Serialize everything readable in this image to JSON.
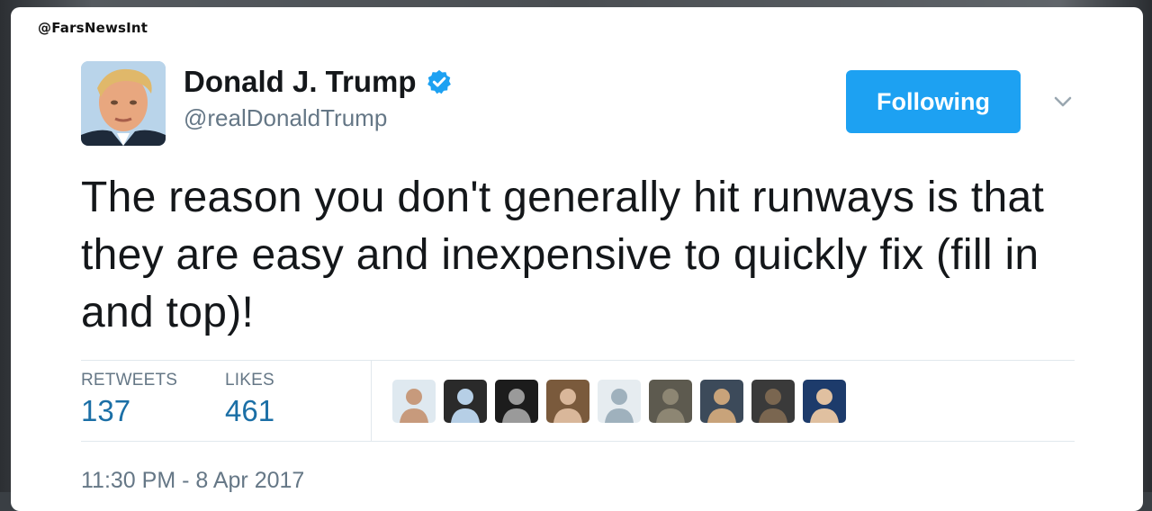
{
  "watermark": "@FarsNewsInt",
  "author": {
    "name": "Donald J. Trump",
    "handle": "@realDonaldTrump",
    "verified": true
  },
  "follow_button": {
    "label": "Following"
  },
  "menu": {
    "icon": "chevron-down-icon"
  },
  "tweet": {
    "text": "The reason you don't generally hit runways is that they are easy and inexpensive to quickly fix (fill in and top)!"
  },
  "stats": {
    "retweets_label": "RETWEETS",
    "retweets_value": "137",
    "likes_label": "LIKES",
    "likes_value": "461"
  },
  "likers": [
    {
      "name": "liker-avatar-1",
      "colors": [
        "#dfe9f0",
        "#c79a7c"
      ]
    },
    {
      "name": "liker-avatar-2",
      "colors": [
        "#2a2a2a",
        "#b6cfe6"
      ]
    },
    {
      "name": "liker-avatar-3",
      "colors": [
        "#1c1c1c",
        "#9a9a9a"
      ]
    },
    {
      "name": "liker-avatar-4",
      "colors": [
        "#7a5a3c",
        "#d9b79a"
      ]
    },
    {
      "name": "liker-avatar-5",
      "colors": [
        "#e6ecf0",
        "#9fb1bd"
      ]
    },
    {
      "name": "liker-avatar-6",
      "colors": [
        "#5d5a4f",
        "#8d8673"
      ]
    },
    {
      "name": "liker-avatar-7",
      "colors": [
        "#3c4a5a",
        "#c8a37a"
      ]
    },
    {
      "name": "liker-avatar-8",
      "colors": [
        "#3a3a3a",
        "#7a6650"
      ]
    },
    {
      "name": "liker-avatar-9",
      "colors": [
        "#1d3b6b",
        "#e0c0a0"
      ]
    }
  ],
  "timestamp": "11:30 PM - 8 Apr 2017",
  "colors": {
    "accent": "#1da1f2",
    "stat_value": "#1b6fa6",
    "muted": "#657786",
    "text": "#14171a"
  }
}
